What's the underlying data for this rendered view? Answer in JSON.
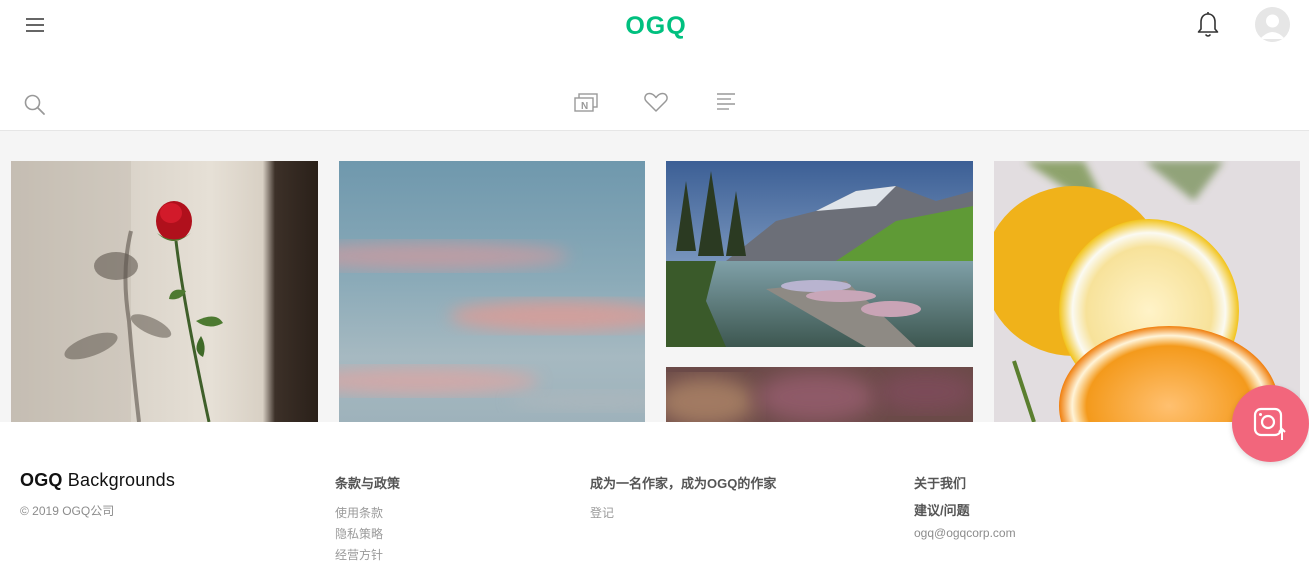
{
  "header": {
    "logo_text": "OGQ",
    "logo_color": "#00c07f",
    "menu_icon": "hamburger-menu-icon",
    "notification_icon": "bell-icon",
    "avatar_icon": "user-avatar-icon",
    "search_icon": "search-icon",
    "tabs": [
      {
        "icon": "new-wallpapers-icon",
        "badge": "N"
      },
      {
        "icon": "heart-icon"
      },
      {
        "icon": "list-icon"
      }
    ]
  },
  "gallery": {
    "photos": [
      {
        "subject": "red-rose-shadow-photo"
      },
      {
        "subject": "pastel-sky-photo"
      },
      {
        "subject": "mountain-lake-dock-photo"
      },
      {
        "subject": "blurred-flowers-photo"
      },
      {
        "subject": "citrus-fruit-photo"
      }
    ]
  },
  "footer": {
    "brand_bold": "OGQ",
    "brand_rest": " Backgrounds",
    "copyright": "© 2019 OGQ公司",
    "policy": {
      "heading": "条款与政策",
      "links": [
        "使用条款",
        "隐私策略",
        "经营方针"
      ]
    },
    "creator": {
      "heading": "成为一名作家，成为OGQ的作家",
      "links": [
        "登记"
      ]
    },
    "about": {
      "heading": "关于我们",
      "feedback": "建议/问题",
      "email": "ogq@ogqcorp.com"
    }
  },
  "upload_button": {
    "icon": "camera-upload-icon",
    "color": "#f2667c"
  }
}
